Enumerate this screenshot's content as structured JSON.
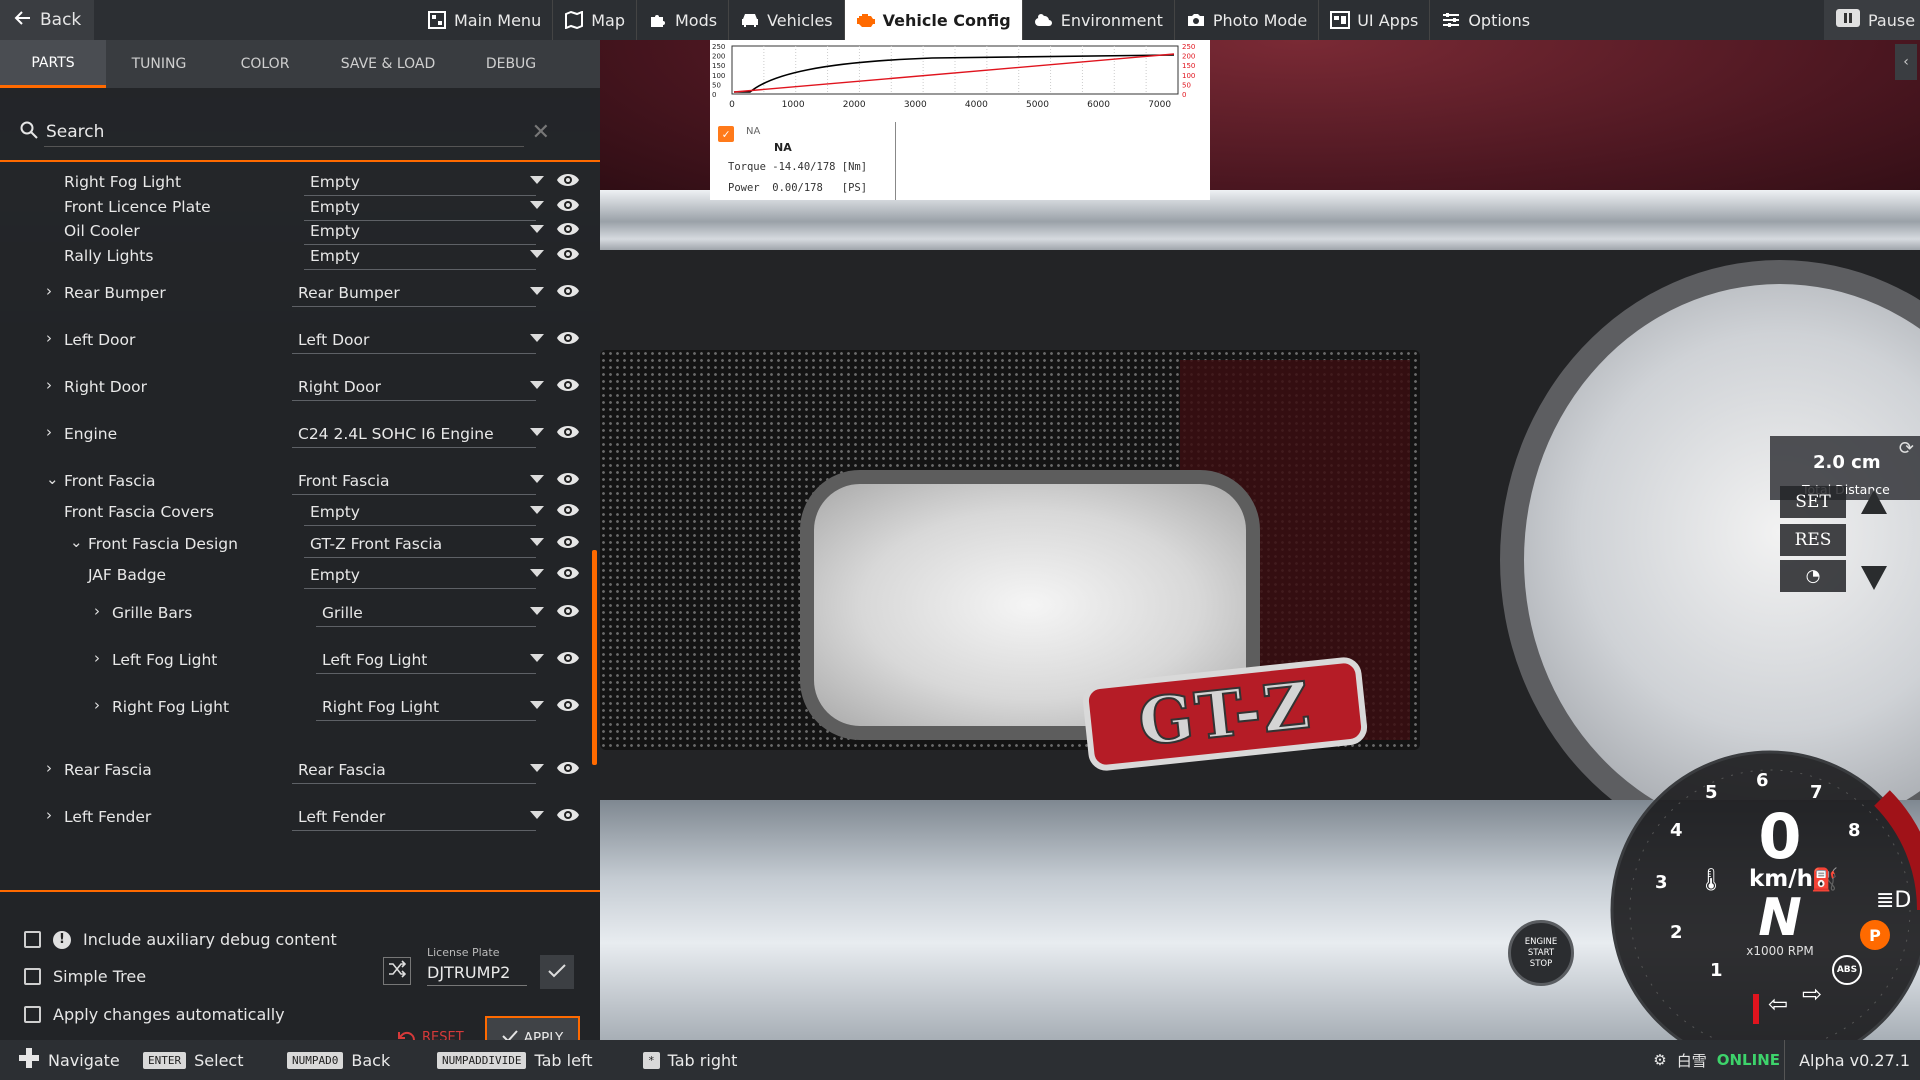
{
  "topbar": {
    "back_label": "Back",
    "nav": [
      {
        "label": "Main Menu",
        "icon": "menu-grid-icon"
      },
      {
        "label": "Map",
        "icon": "map-icon"
      },
      {
        "label": "Mods",
        "icon": "puzzle-icon"
      },
      {
        "label": "Vehicles",
        "icon": "car-icon"
      },
      {
        "label": "Vehicle Config",
        "icon": "engine-icon",
        "active": true
      },
      {
        "label": "Environment",
        "icon": "weather-icon"
      },
      {
        "label": "Photo Mode",
        "icon": "camera-icon"
      },
      {
        "label": "UI Apps",
        "icon": "apps-icon"
      },
      {
        "label": "Options",
        "icon": "sliders-icon"
      }
    ],
    "pause_label": "Pause"
  },
  "panel": {
    "tabs": [
      "PARTS",
      "TUNING",
      "COLOR",
      "SAVE & LOAD",
      "DEBUG"
    ],
    "active_tab": "PARTS",
    "search_placeholder": "Search",
    "parts": [
      {
        "name": "Right Fog Light",
        "value": "Empty"
      },
      {
        "name": "Front Licence Plate",
        "value": "Empty"
      },
      {
        "name": "Oil Cooler",
        "value": "Empty"
      },
      {
        "name": "Rally Lights",
        "value": "Empty"
      },
      {
        "name": "Rear Bumper",
        "value": "Rear Bumper"
      },
      {
        "name": "Left Door",
        "value": "Left Door"
      },
      {
        "name": "Right Door",
        "value": "Right Door"
      },
      {
        "name": "Engine",
        "value": "C24 2.4L SOHC I6 Engine"
      },
      {
        "name": "Front Fascia",
        "value": "Front Fascia"
      },
      {
        "name": "Front Fascia Covers",
        "value": "Empty"
      },
      {
        "name": "Front Fascia Design",
        "value": "GT-Z Front Fascia"
      },
      {
        "name": "JAF Badge",
        "value": "Empty"
      },
      {
        "name": "Grille Bars",
        "value": "Grille"
      },
      {
        "name": "Left Fog Light",
        "value": "Left Fog Light"
      },
      {
        "name": "Right Fog Light",
        "value": "Right Fog Light"
      },
      {
        "name": "Rear Fascia",
        "value": "Rear Fascia"
      },
      {
        "name": "Left Fender",
        "value": "Left Fender"
      }
    ],
    "options": {
      "aux_debug": "Include auxiliary debug content",
      "simple_tree": "Simple Tree",
      "auto_apply": "Apply changes automatically"
    },
    "license_plate_label": "License Plate",
    "license_plate_value": "DJTRUMP2",
    "reset_label": "RESET",
    "apply_label": "APPLY"
  },
  "graph": {
    "x_ticks": [
      "0",
      "1000",
      "2000",
      "3000",
      "4000",
      "5000",
      "6000",
      "7000"
    ],
    "y_ticks": [
      "250",
      "200",
      "150",
      "100",
      "50",
      "0"
    ],
    "legend_small": "NA",
    "legend_name": "NA",
    "torque": "Torque -14.40/178 [Nm]",
    "power": "Power  0.00/178   [PS]",
    "colors": {
      "torque": "#000000",
      "power": "#e0141e"
    }
  },
  "hud": {
    "distance_value": "2.0 cm",
    "distance_label": "Total Distance",
    "cruise": [
      "SET",
      "RES"
    ],
    "speed": "0",
    "speed_unit": "km/h",
    "gear": "N",
    "rpm_label": "x1000 RPM",
    "rpm_ticks": [
      "1",
      "2",
      "3",
      "4",
      "5",
      "6",
      "7",
      "8"
    ],
    "engine_button": [
      "ENGINE",
      "START",
      "STOP"
    ]
  },
  "scene": {
    "badge_text": "GT-Z"
  },
  "bottombar": {
    "hints": [
      {
        "key": "",
        "label": "Navigate"
      },
      {
        "key": "ENTER",
        "label": "Select"
      },
      {
        "key": "NUMPAD0",
        "label": "Back"
      },
      {
        "key": "NUMPADDIVIDE",
        "label": "Tab left"
      },
      {
        "key": "*",
        "label": "Tab right"
      }
    ],
    "username": "白雪",
    "online_status": "ONLINE",
    "version": "Alpha v0.27.1"
  }
}
